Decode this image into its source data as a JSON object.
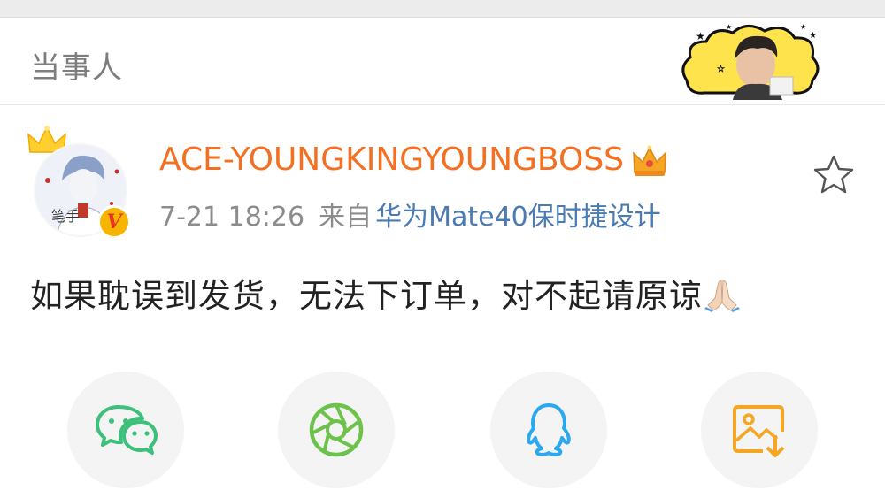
{
  "header": {
    "title": "当事人"
  },
  "post": {
    "username": "ACE-YOUNGKINGYOUNGBOSS",
    "timestamp": "7-21 18:26",
    "from_label": "来自",
    "device": "华为Mate40保时捷设计",
    "content": "如果耽误到发货，无法下订单，对不起请原谅"
  },
  "colors": {
    "username": "#f36f21",
    "device_link": "#4a7bb5",
    "wechat": "#3cc07a",
    "moments": "#6cc24a",
    "qq": "#2aa8f2",
    "save_image": "#f5a623"
  },
  "share": {
    "buttons": [
      {
        "icon": "wechat-icon"
      },
      {
        "icon": "moments-icon"
      },
      {
        "icon": "qq-icon"
      },
      {
        "icon": "save-image-icon"
      }
    ]
  }
}
